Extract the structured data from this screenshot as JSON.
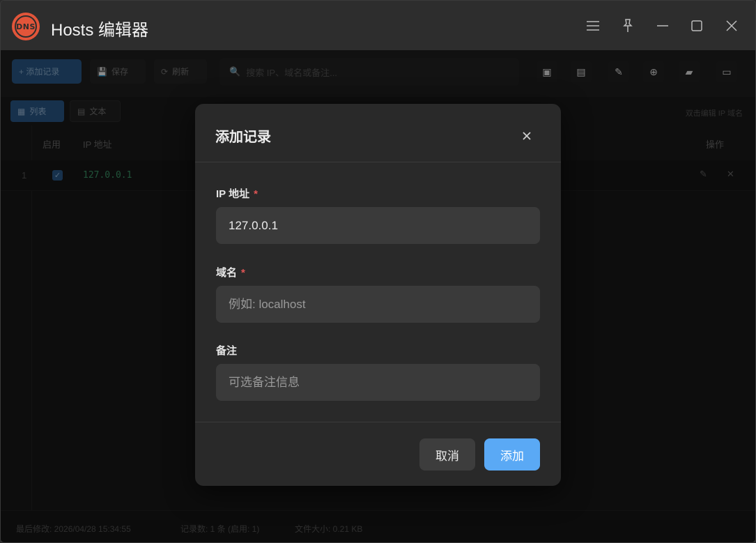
{
  "window": {
    "title": "Hosts 编辑器",
    "logo_text": "DNS"
  },
  "toolbar": {
    "add_label": "+ 添加记录",
    "save_label": "保存",
    "refresh_label": "刷新",
    "search_placeholder": "搜索 IP、域名或备注..."
  },
  "tabs": {
    "list_label": "列表",
    "text_label": "文本",
    "hint": "双击编辑 IP 域名"
  },
  "table": {
    "headers": {
      "enabled": "启用",
      "ip": "IP 地址",
      "actions": "操作"
    },
    "rows": [
      {
        "index": "1",
        "ip": "127.0.0.1"
      }
    ]
  },
  "statusbar": {
    "modified": "最后修改: 2026/04/28 15:34:55",
    "records": "记录数: 1 条 (启用: 1)",
    "filesize": "文件大小: 0.21 KB"
  },
  "dialog": {
    "title": "添加记录",
    "ip_label": "IP 地址",
    "ip_value": "127.0.0.1",
    "domain_label": "域名",
    "domain_placeholder": "例如: localhost",
    "note_label": "备注",
    "note_placeholder": "可选备注信息",
    "required_mark": "*",
    "cancel_label": "取消",
    "add_label": "添加"
  },
  "colors": {
    "accent": "#5aa9f5",
    "logo": "#e2553a",
    "required": "#e05555"
  }
}
